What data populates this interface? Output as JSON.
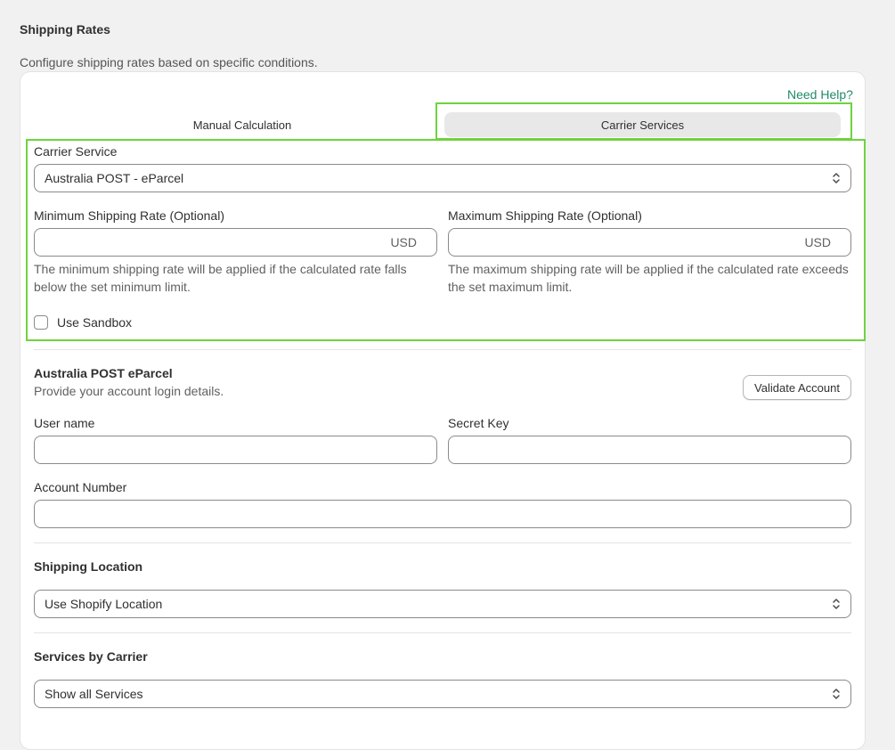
{
  "page": {
    "title": "Shipping Rates",
    "description": "Configure shipping rates based on specific conditions."
  },
  "card": {
    "help_link": "Need Help?",
    "tabs": [
      {
        "label": "Manual Calculation",
        "selected": false
      },
      {
        "label": "Carrier Services",
        "selected": true
      }
    ]
  },
  "carrier_form": {
    "carrier_label": "Carrier Service",
    "carrier_value": "Australia POST - eParcel",
    "min_label": "Minimum Shipping Rate (Optional)",
    "min_value": "",
    "min_suffix": "USD",
    "min_help": "The minimum shipping rate will be applied if the calculated rate falls below the set minimum limit.",
    "max_label": "Maximum Shipping Rate (Optional)",
    "max_value": "",
    "max_suffix": "USD",
    "max_help": "The maximum shipping rate will be applied if the calculated rate exceeds the set maximum limit.",
    "sandbox_label": "Use Sandbox",
    "sandbox_checked": false
  },
  "account": {
    "title": "Australia POST eParcel",
    "subtitle": "Provide your account login details.",
    "validate_button": "Validate Account",
    "username_label": "User name",
    "username_value": "",
    "secret_label": "Secret Key",
    "secret_value": "",
    "account_number_label": "Account Number",
    "account_number_value": ""
  },
  "shipping_location": {
    "title": "Shipping Location",
    "value": "Use Shopify Location"
  },
  "services": {
    "title": "Services by Carrier",
    "value": "Show all Services"
  },
  "colors": {
    "highlight": "#6ed33e",
    "link": "#1f8a6a",
    "selected_tab": "#e8e8e8"
  }
}
